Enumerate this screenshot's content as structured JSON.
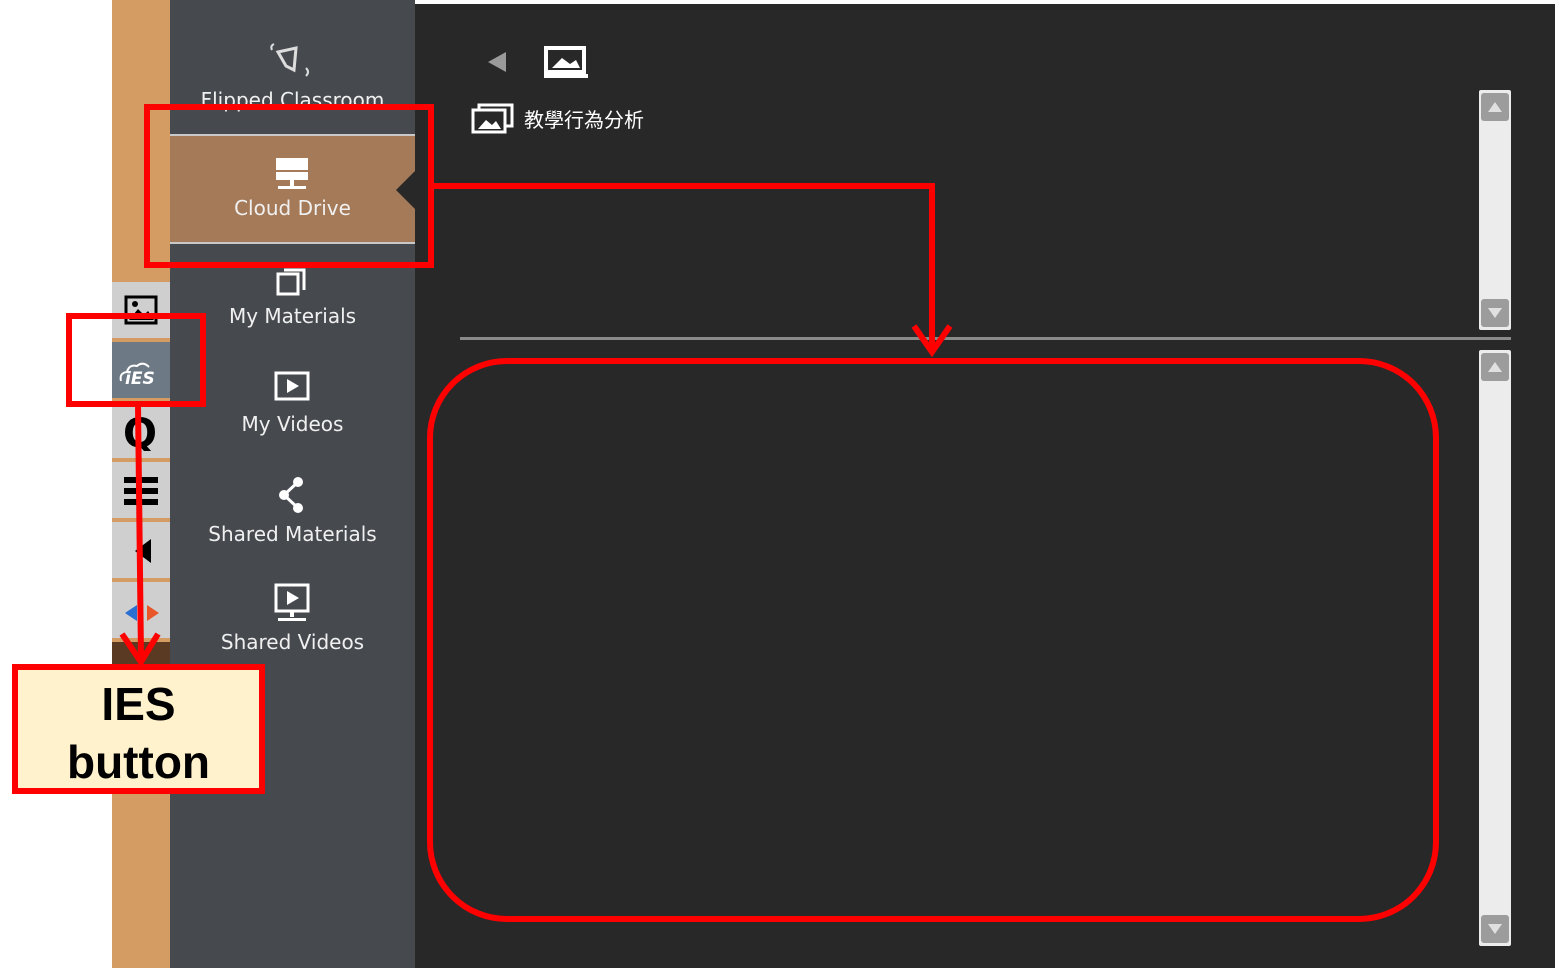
{
  "nav": {
    "items": [
      {
        "label": "Flipped Classroom",
        "icon": "flipped-classroom-icon"
      },
      {
        "label": "Cloud Drive",
        "icon": "cloud-drive-icon",
        "selected": true
      },
      {
        "label": "My Materials",
        "icon": "my-materials-icon"
      },
      {
        "label": "My Videos",
        "icon": "my-videos-icon"
      },
      {
        "label": "Shared Materials",
        "icon": "share-icon"
      },
      {
        "label": "Shared Videos",
        "icon": "shared-videos-icon"
      }
    ]
  },
  "toolbar": {
    "items": [
      "image-icon",
      "ies-icon",
      "q-icon",
      "menu-icon",
      "speaker-icon",
      "arrows-icon"
    ]
  },
  "main": {
    "folder_name": "教學行為分析",
    "back_icon": "back-arrow-icon",
    "header_icon": "presentation-icon"
  },
  "annotation": {
    "callout_line1": "IES",
    "callout_line2": "button"
  },
  "colors": {
    "strip": "#d49c62",
    "nav_bg": "#464a4f",
    "selected_bg": "#a57a58",
    "main_bg": "#282828",
    "annotation": "#ff0000",
    "callout_bg": "#fff2cc"
  }
}
